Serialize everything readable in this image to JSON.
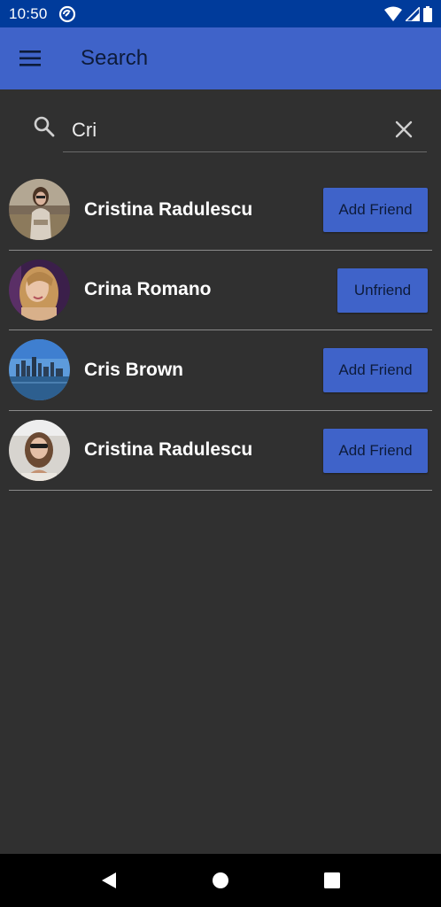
{
  "status_bar": {
    "time": "10:50"
  },
  "app_bar": {
    "title": "Search"
  },
  "search": {
    "value": "Cri",
    "placeholder": ""
  },
  "results": [
    {
      "name": "Cristina Radulescu",
      "action": "Add Friend"
    },
    {
      "name": "Crina Romano",
      "action": "Unfriend"
    },
    {
      "name": "Cris Brown",
      "action": "Add Friend"
    },
    {
      "name": "Cristina Radulescu",
      "action": "Add Friend"
    }
  ],
  "colors": {
    "status_bar": "#003b9b",
    "app_bar": "#3f63c9",
    "background": "#303030",
    "button": "#3f63c9",
    "caret": "#7b91ff"
  },
  "icons": {
    "app_bar_menu": "hamburger-menu-icon",
    "search": "search-icon",
    "clear": "close-icon",
    "nav": [
      "back-icon",
      "home-icon",
      "recents-icon"
    ]
  }
}
